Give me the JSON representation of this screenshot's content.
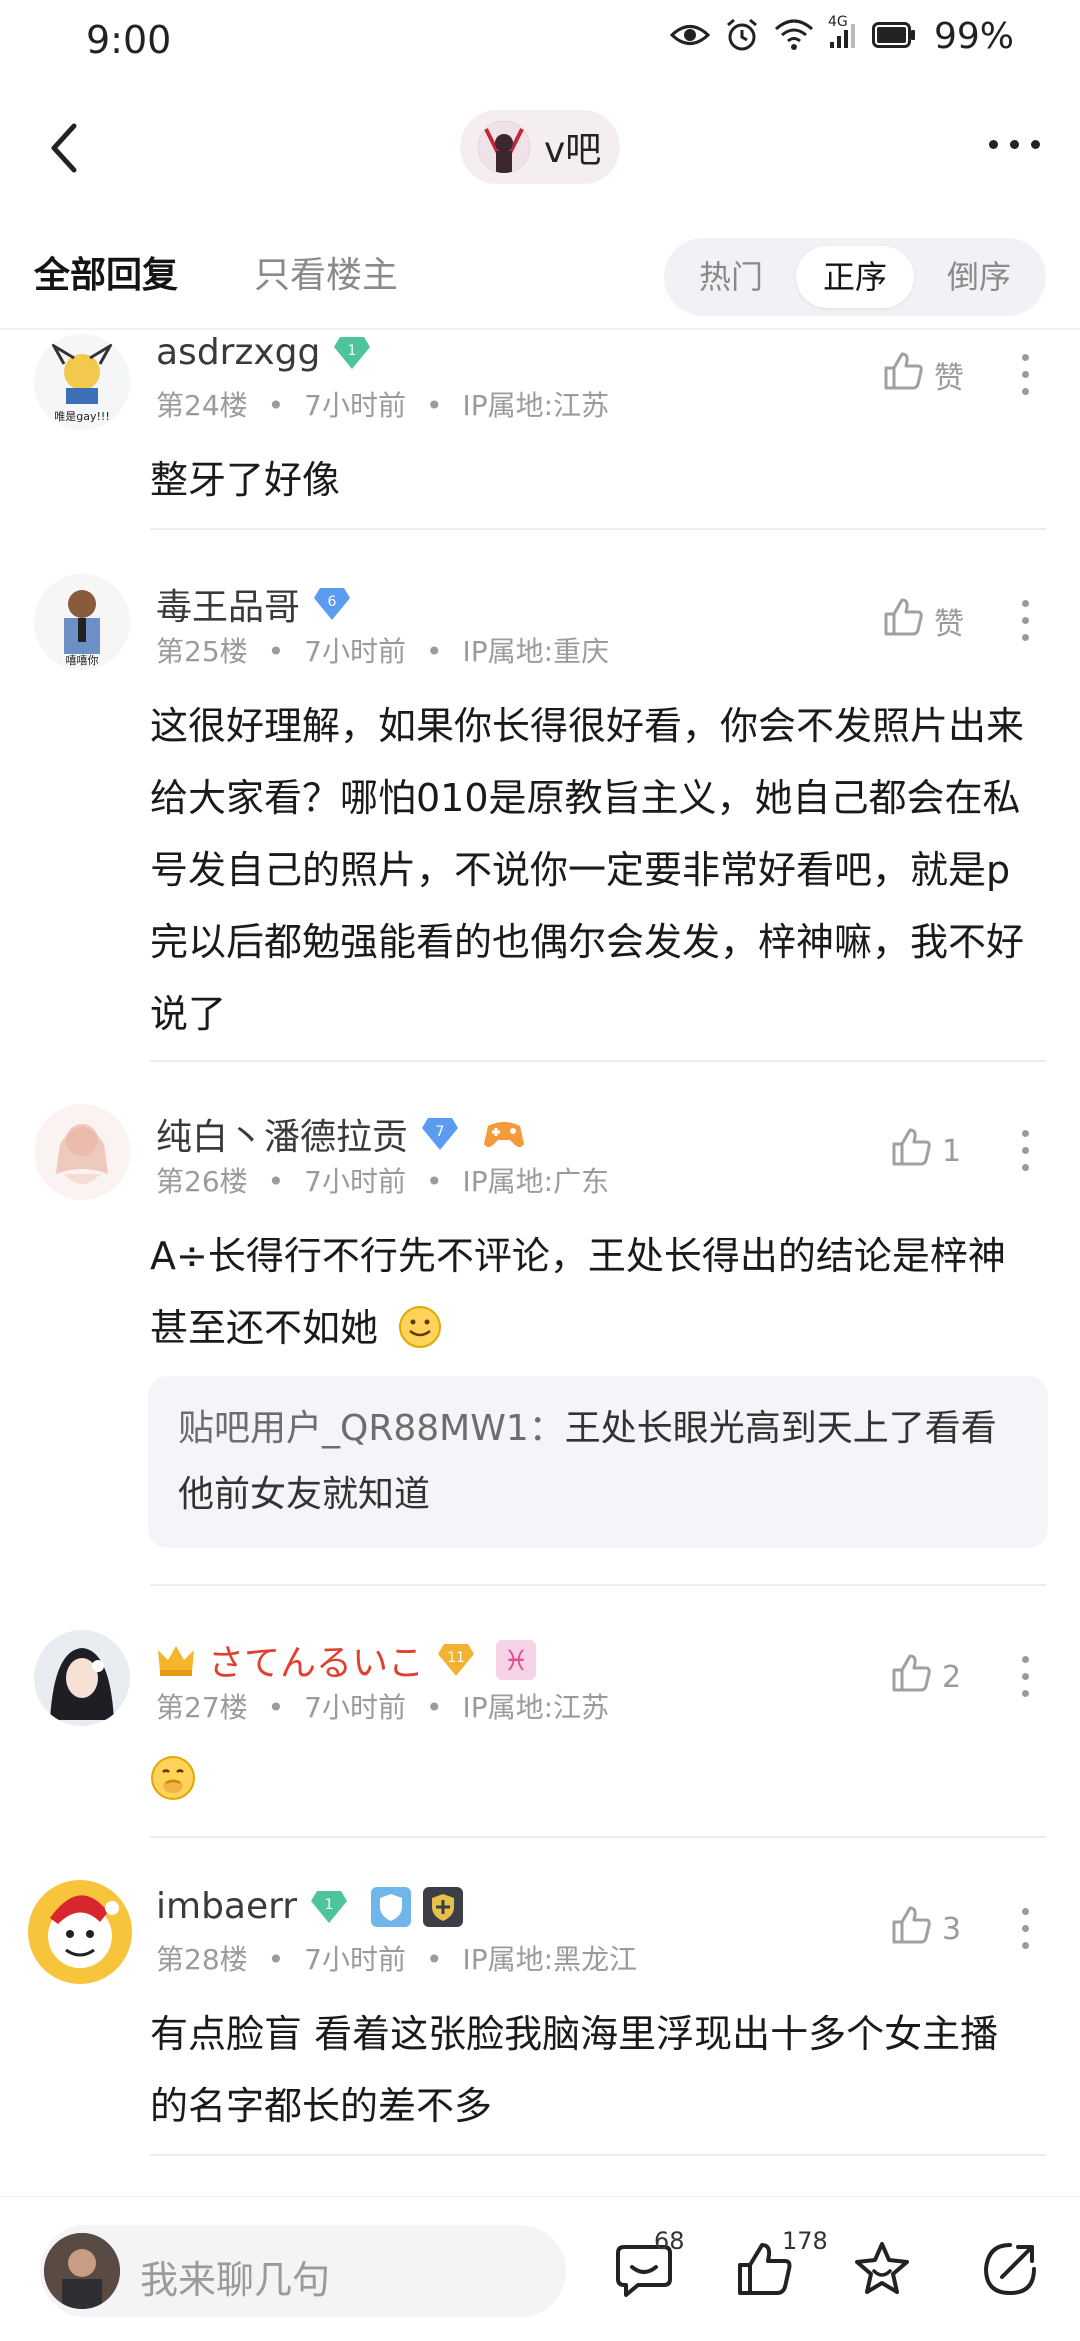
{
  "status_bar": {
    "time": "9:00",
    "network": "4G",
    "battery": "99%"
  },
  "nav": {
    "forum_name": "v吧"
  },
  "tabs": {
    "all_replies": "全部回复",
    "op_only": "只看楼主",
    "sort": [
      "热门",
      "正序",
      "倒序"
    ],
    "active_sort": "正序"
  },
  "posts": [
    {
      "username": "asdrzxgg",
      "level": "1",
      "floor": "第24楼",
      "time": "7小时前",
      "ip": "IP属地:江苏",
      "like_label": "赞",
      "content": "整牙了好像",
      "avatar_text": "唯是gay!!!"
    },
    {
      "username": "毒王品哥",
      "level": "6",
      "floor": "第25楼",
      "time": "7小时前",
      "ip": "IP属地:重庆",
      "like_label": "赞",
      "content": "这很好理解，如果你长得很好看，你会不发照片出来给大家看？哪怕010是原教旨主义，她自己都会在私号发自己的照片，不说你一定要非常好看吧，就是p完以后都勉强能看的也偶尔会发发，梓神嘛，我不好说了",
      "avatar_text": "嘻嘻你"
    },
    {
      "username": "纯白丶潘德拉贡",
      "level": "7",
      "floor": "第26楼",
      "time": "7小时前",
      "ip": "IP属地:广东",
      "like_label": "1",
      "content": "A÷长得行不行先不评论，王处长得出的结论是梓神甚至还不如她",
      "quote_user": "贴吧用户_QR88MW1：",
      "quote_text": "王处长眼光高到天上了看看他前女友就知道"
    },
    {
      "username": "さてんるいこ",
      "level": "11",
      "floor": "第27楼",
      "time": "7小时前",
      "ip": "IP属地:江苏",
      "like_label": "2",
      "content": "",
      "name_color": "#e0402f",
      "zodiac": "♓"
    },
    {
      "username": "imbaerr",
      "level": "1",
      "floor": "第28楼",
      "time": "7小时前",
      "ip": "IP属地:黑龙江",
      "like_label": "3",
      "content": "有点脸盲 看着这张脸我脑海里浮现出十多个女主播的名字都长的差不多"
    }
  ],
  "bottom_bar": {
    "placeholder": "我来聊几句",
    "comment_count": "68",
    "like_count": "178"
  },
  "icons": [
    "eye-icon",
    "alarm-icon",
    "wifi-icon",
    "signal-icon",
    "battery-icon",
    "back-icon",
    "more-icon",
    "thumb-up-icon",
    "kebab-icon",
    "smile-emoji-icon",
    "shush-emoji-icon",
    "comment-icon",
    "star-icon",
    "share-icon",
    "crown-icon",
    "shield-icon",
    "guard-icon",
    "game-icon"
  ],
  "colors": {
    "accent_red": "#e0402f",
    "level_green": "#4ec49b",
    "level_blue": "#5b9cf1",
    "level_gold": "#f2b233",
    "zodiac_pink": "#f26ca4"
  }
}
